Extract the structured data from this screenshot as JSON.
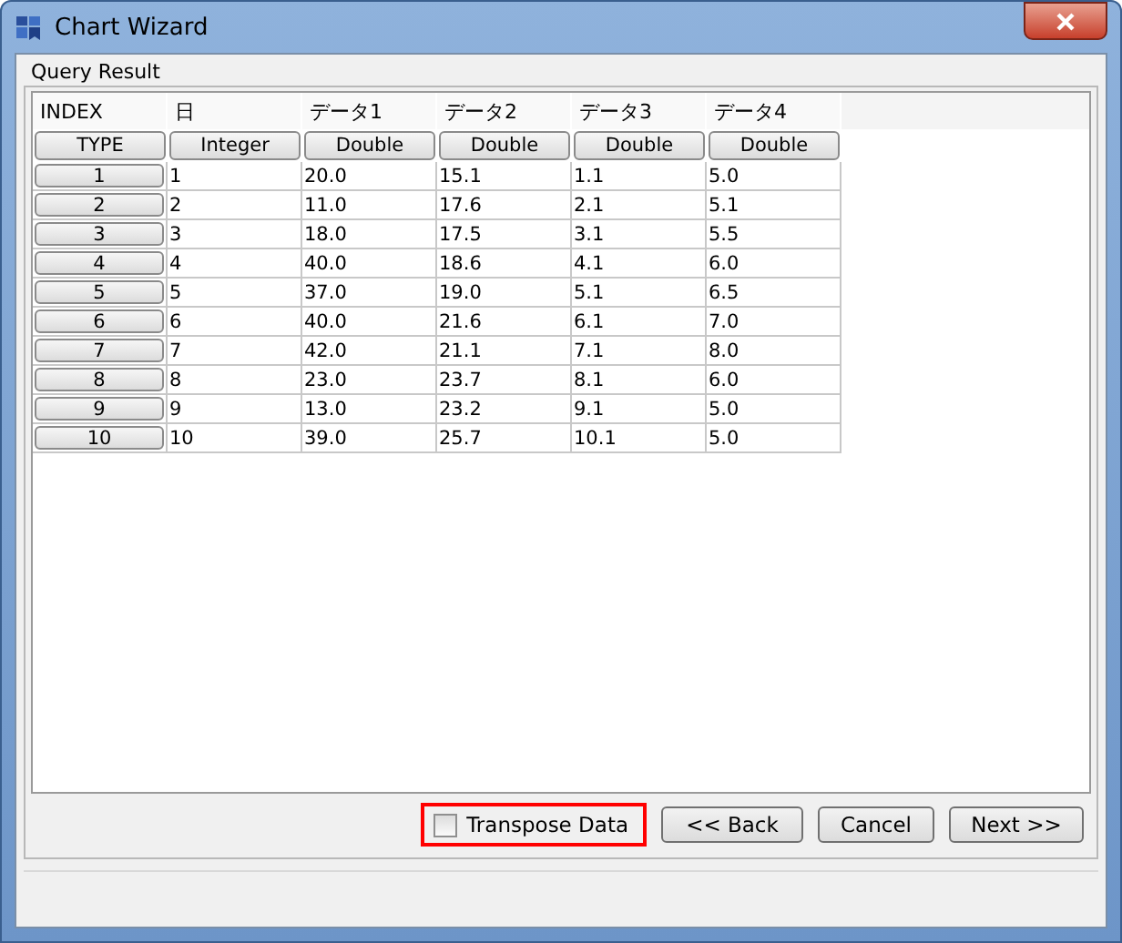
{
  "window": {
    "title": "Chart Wizard"
  },
  "group": {
    "title": "Query Result"
  },
  "table": {
    "columns": [
      "INDEX",
      "日",
      "データ1",
      "データ2",
      "データ3",
      "データ4"
    ],
    "rows": [
      [
        "TYPE",
        "Integer",
        "Double",
        "Double",
        "Double",
        "Double"
      ],
      [
        "1",
        "1",
        "20.0",
        "15.1",
        "1.1",
        "5.0"
      ],
      [
        "2",
        "2",
        "11.0",
        "17.6",
        "2.1",
        "5.1"
      ],
      [
        "3",
        "3",
        "18.0",
        "17.5",
        "3.1",
        "5.5"
      ],
      [
        "4",
        "4",
        "40.0",
        "18.6",
        "4.1",
        "6.0"
      ],
      [
        "5",
        "5",
        "37.0",
        "19.0",
        "5.1",
        "6.5"
      ],
      [
        "6",
        "6",
        "40.0",
        "21.6",
        "6.1",
        "7.0"
      ],
      [
        "7",
        "7",
        "42.0",
        "21.1",
        "7.1",
        "8.0"
      ],
      [
        "8",
        "8",
        "23.0",
        "23.7",
        "8.1",
        "6.0"
      ],
      [
        "9",
        "9",
        "13.0",
        "23.2",
        "9.1",
        "5.0"
      ],
      [
        "10",
        "10",
        "39.0",
        "25.7",
        "10.1",
        "5.0"
      ]
    ]
  },
  "transpose": {
    "label": "Transpose Data",
    "checked": false,
    "highlighted": true
  },
  "buttons": [
    "<< Back",
    "Cancel",
    "Next >>"
  ]
}
